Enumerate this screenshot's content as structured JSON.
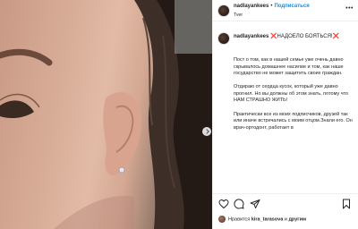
{
  "post": {
    "username": "nadlayankees",
    "separator": "•",
    "follow_label": "Подписаться",
    "location": "Tver",
    "more_label": "•••"
  },
  "caption": {
    "username": "nadlayankees",
    "headline": "❌НАДОЕЛО БОЯТЬСЯ!❌",
    "paragraphs": [
      "Пост о том, как в нашей семье уже очень давно скрывалось домашнее насилие и том, как наше государство не может защитить своих граждан.",
      "Отдираю от сердца кусок, который уже давно прогнил. Но вы должны об этом знать, потому что НАМ СТРАШНО ЖИТЬ!",
      "Практически все из моих подписчиков, друзей так или иначе встречались с моим отцом.Знали его. Он врач-ортодонт, работает в"
    ]
  },
  "likes": {
    "prefix": "Нравится",
    "user": "kira_tarasova",
    "suffix": "и",
    "others": "другим"
  },
  "icons": [
    "more-icon",
    "like-icon",
    "comment-icon",
    "share-icon",
    "save-icon",
    "carousel-next-icon"
  ],
  "colors": {
    "accent": "#0095f6",
    "text": "#262626",
    "border": "#efefef"
  }
}
